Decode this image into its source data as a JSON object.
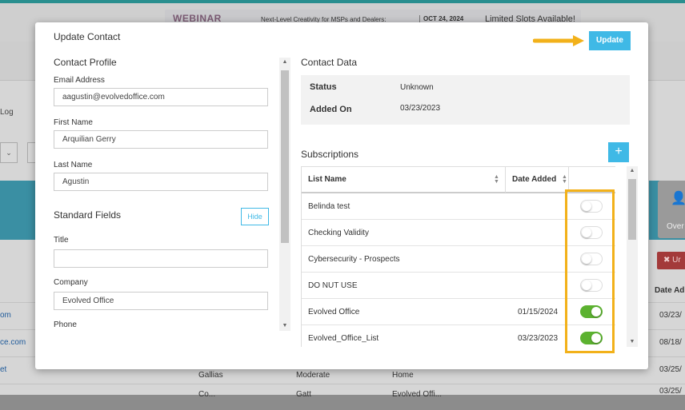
{
  "background": {
    "banner": {
      "webinar": "WEBINAR",
      "text": "Next-Level Creativity for MSPs and Dealers:",
      "date": "OCT 24, 2024",
      "slots": "Limited Slots Available!"
    },
    "log_label": "Log",
    "card_label": "Over",
    "red_button": "Ur",
    "date_header": "Date Ad",
    "rows": [
      {
        "link": "om",
        "date": "03/23/"
      },
      {
        "link": "ce.com",
        "date": "08/18/"
      },
      {
        "link": "et",
        "cells": [
          "Gallias",
          "Moderate",
          "Home"
        ],
        "date": "03/25/"
      },
      {
        "cells": [
          "Co...",
          "Gatt",
          "Evolved Offi..."
        ],
        "date": "03/25/"
      }
    ]
  },
  "modal": {
    "title": "Update Contact",
    "update_label": "Update",
    "contact_profile": {
      "heading": "Contact Profile",
      "email_label": "Email Address",
      "email_value": "aagustin@evolvedoffice.com",
      "first_name_label": "First Name",
      "first_name_value": "Arquilian Gerry",
      "last_name_label": "Last Name",
      "last_name_value": "Agustin"
    },
    "standard_fields": {
      "heading": "Standard Fields",
      "hide_label": "Hide",
      "title_label": "Title",
      "title_value": "",
      "company_label": "Company",
      "company_value": "Evolved Office",
      "phone_label": "Phone"
    },
    "contact_data": {
      "heading": "Contact Data",
      "status_label": "Status",
      "status_value": "Unknown",
      "added_on_label": "Added On",
      "added_on_value": "03/23/2023"
    },
    "subscriptions": {
      "heading": "Subscriptions",
      "add_icon": "plus-icon",
      "columns": {
        "list_name": "List Name",
        "date_added": "Date Added"
      },
      "rows": [
        {
          "name": "Belinda test",
          "date": "",
          "subscribed": false
        },
        {
          "name": "Checking Validity",
          "date": "",
          "subscribed": false
        },
        {
          "name": "Cybersecurity - Prospects",
          "date": "",
          "subscribed": false
        },
        {
          "name": "DO NUT USE",
          "date": "",
          "subscribed": false
        },
        {
          "name": "Evolved Office",
          "date": "01/15/2024",
          "subscribed": true
        },
        {
          "name": "Evolved_Office_List",
          "date": "03/23/2023",
          "subscribed": true
        }
      ]
    },
    "colors": {
      "accent": "#3fb9e6",
      "toggle_on": "#5cb230",
      "highlight": "#f2b11a"
    }
  }
}
